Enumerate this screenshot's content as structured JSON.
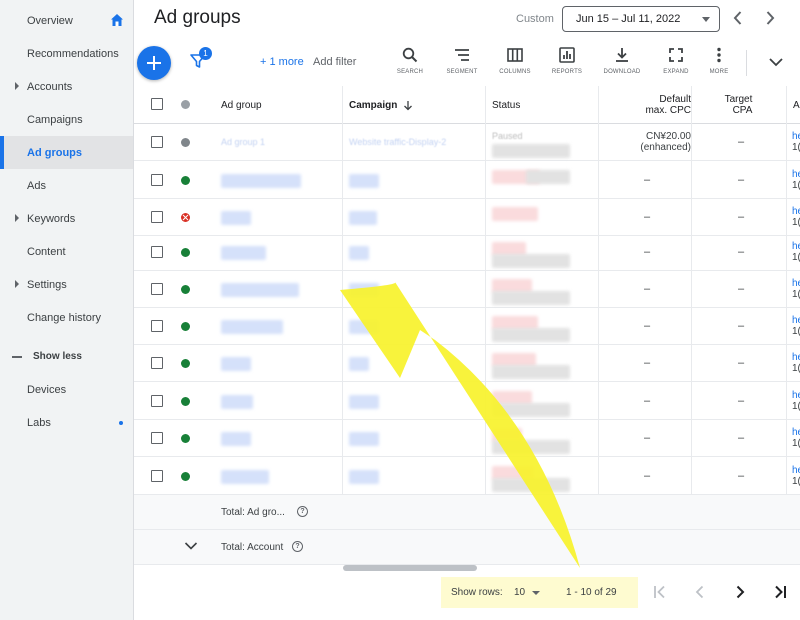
{
  "sidebar": {
    "items": [
      {
        "label": "Overview"
      },
      {
        "label": "Recommendations"
      },
      {
        "label": "Accounts"
      },
      {
        "label": "Campaigns"
      },
      {
        "label": "Ad groups"
      },
      {
        "label": "Ads"
      },
      {
        "label": "Keywords"
      },
      {
        "label": "Content"
      },
      {
        "label": "Settings"
      },
      {
        "label": "Change history"
      }
    ],
    "show_less": "Show less",
    "extra": [
      {
        "label": "Devices"
      },
      {
        "label": "Labs"
      }
    ]
  },
  "header": {
    "title": "Ad groups",
    "custom_label": "Custom",
    "date_range": "Jun 15 – Jul 11, 2022"
  },
  "toolbar": {
    "filter_count": "1",
    "more_filters": "+ 1 more",
    "add_filter": "Add filter",
    "tools": [
      "SEARCH",
      "SEGMENT",
      "COLUMNS",
      "REPORTS",
      "DOWNLOAD",
      "EXPAND",
      "MORE"
    ]
  },
  "table": {
    "headers": {
      "ad_group": "Ad group",
      "campaign": "Campaign",
      "status": "Status",
      "default_cpc_line1": "Default",
      "default_cpc_line2": "max. CPC",
      "target_cpa_line1": "Target",
      "target_cpa_line2": "CPA",
      "truncated": "A"
    },
    "first_row": {
      "ad_group": "Ad group 1",
      "campaign": "Website traffic-Display-2",
      "status": "Paused",
      "cpc_line1": "CN¥20.00",
      "cpc_line2": "(enhanced)",
      "cpa": "–"
    },
    "dash": "–",
    "link_frag": "he",
    "sub_frag": "1(",
    "totals": {
      "ad_group": "Total: Ad gro...",
      "account": "Total: Account"
    },
    "help": "?"
  },
  "pagination": {
    "show_rows_label": "Show rows:",
    "rows_value": "10",
    "range": "1 - 10 of 29"
  },
  "colors": {
    "accent": "#1a73e8",
    "enabled": "#188038",
    "removed": "#d93025",
    "highlight": "#fefbd0",
    "annotation_arrow": "#f7f22b"
  }
}
